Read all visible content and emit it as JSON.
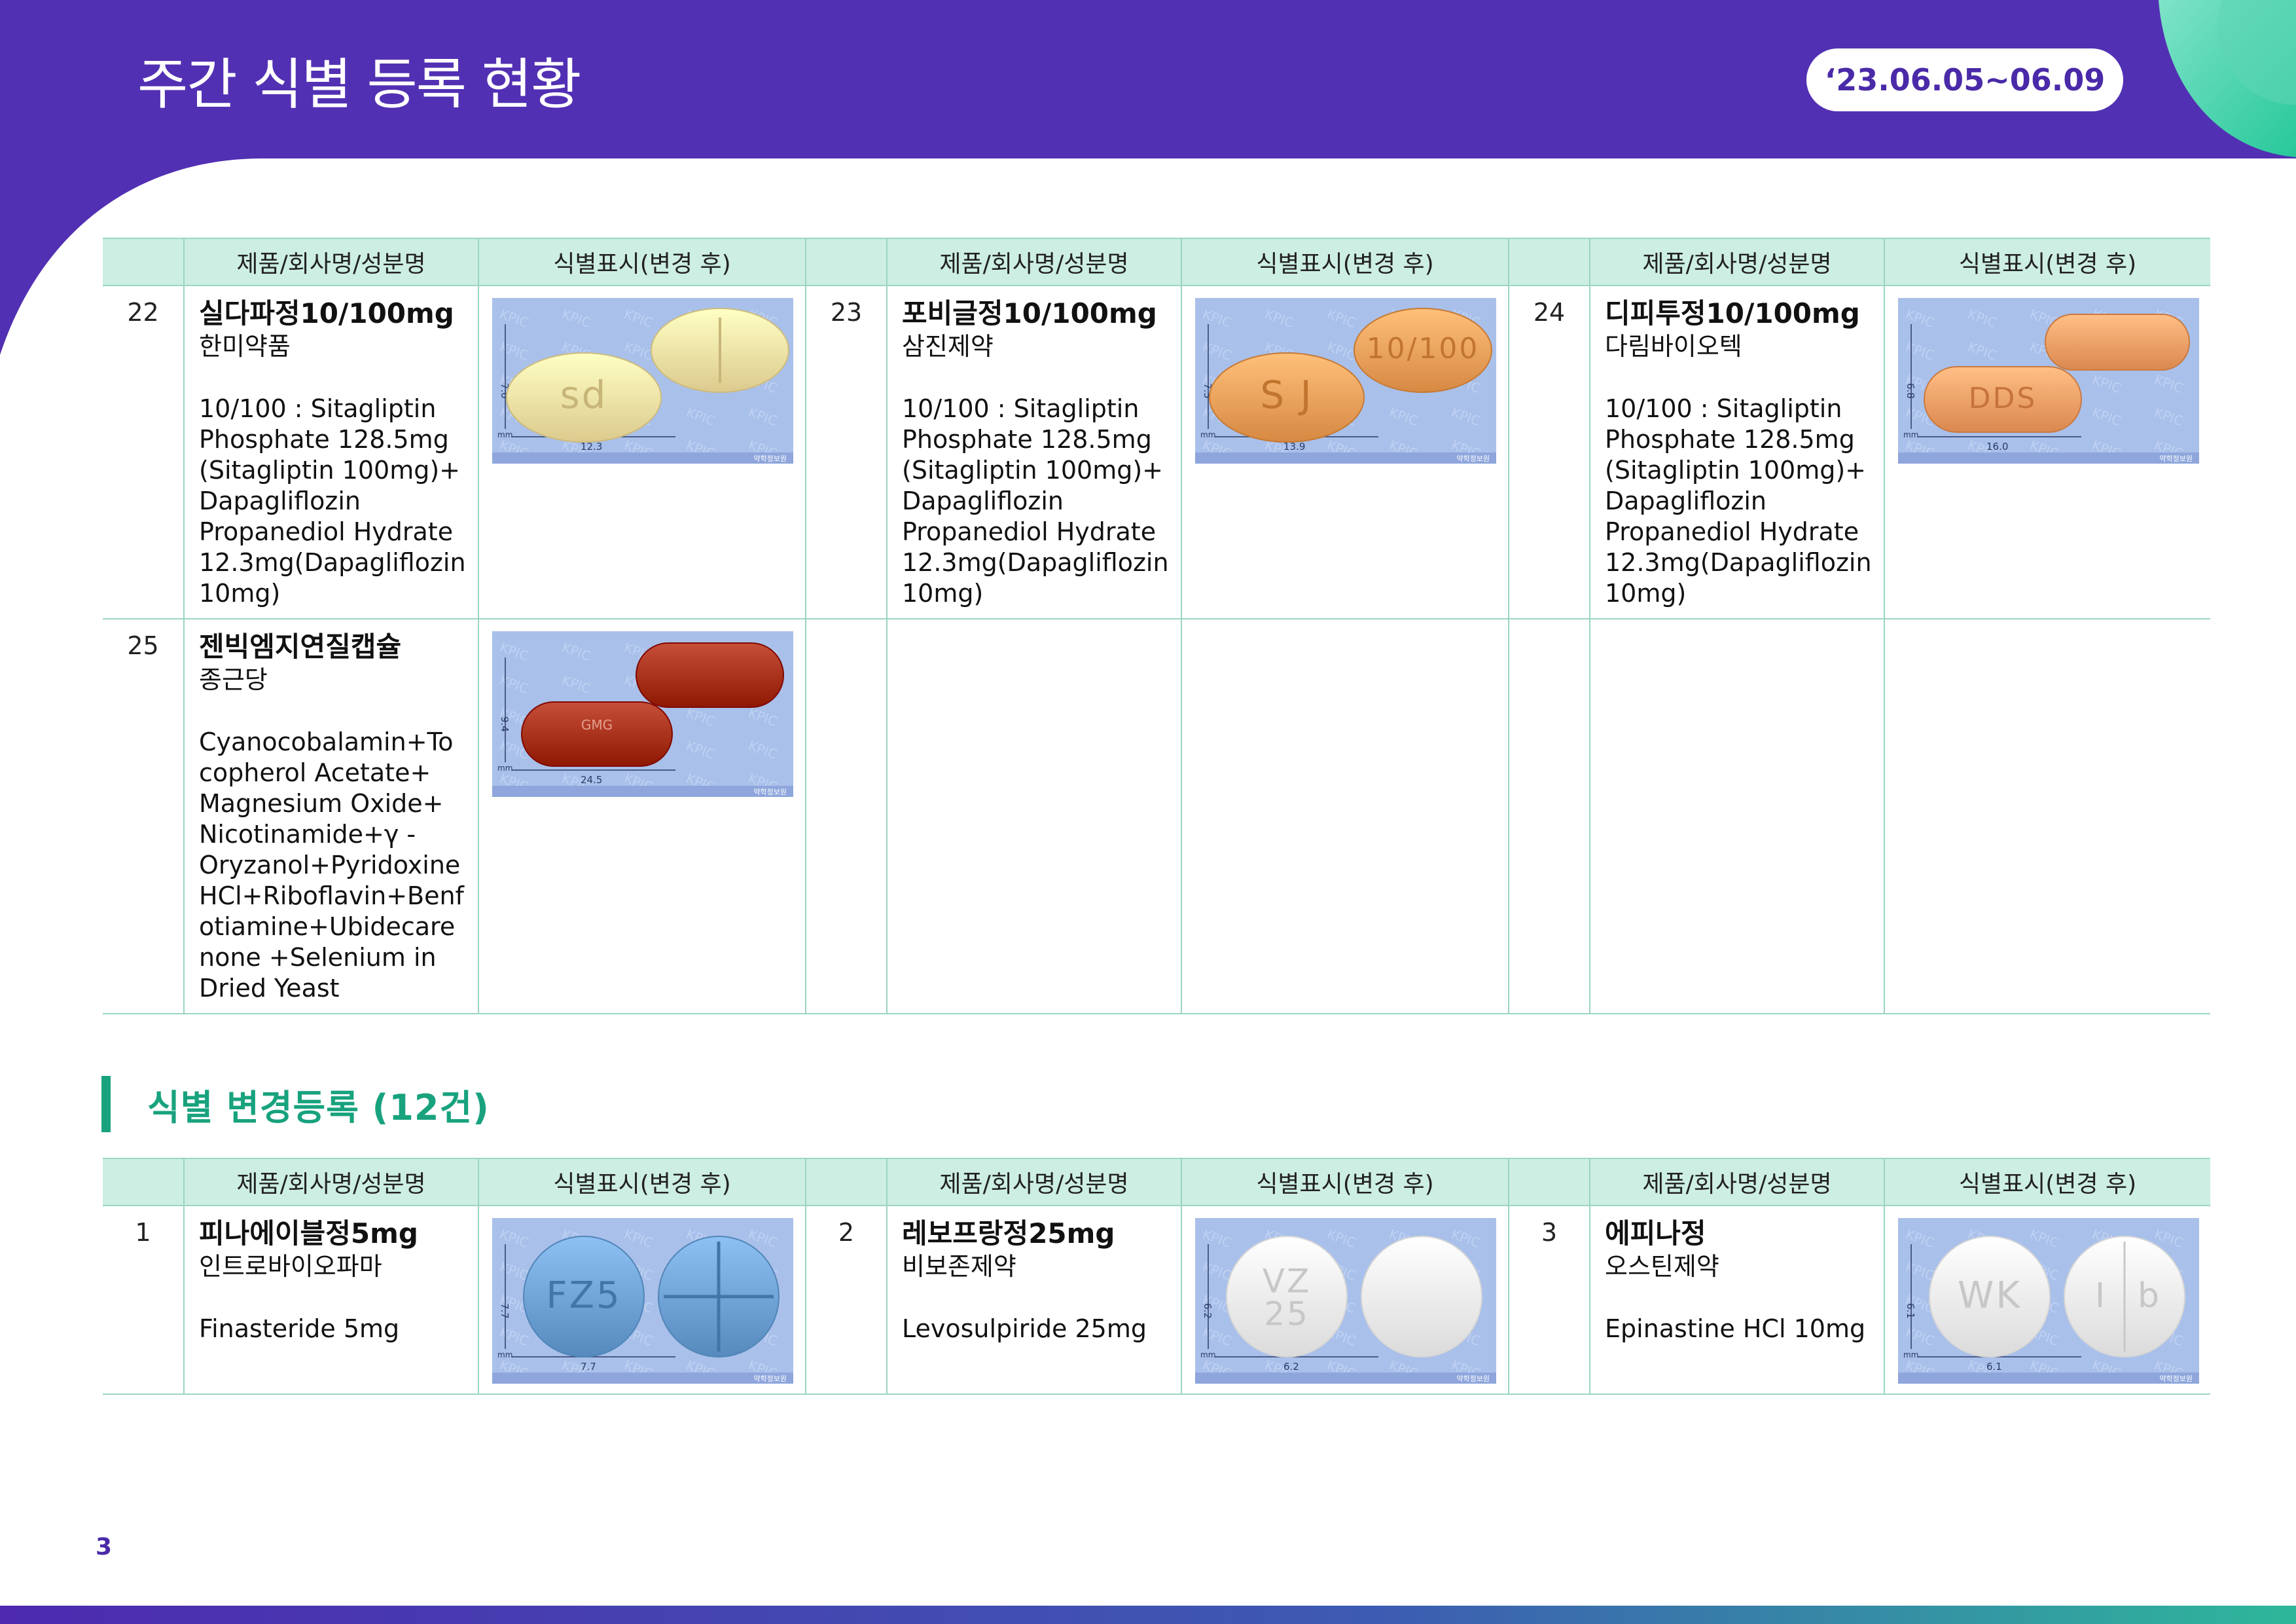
{
  "page": {
    "title": "주간 식별 등록 현황",
    "date_range": "‘23.06.05~06.09",
    "page_number": "3"
  },
  "colors": {
    "header": "#5230b3",
    "accent_green": "#18a27e",
    "table_header": "#cdeee3"
  },
  "table_headers": {
    "product": "제품/회사명/성분명",
    "marking": "식별표시(변경 후)"
  },
  "new_registrations": [
    {
      "no": "22",
      "name": "실다파정10/100mg",
      "company": "한미약품",
      "ingredients": "10/100 : Sitagliptin Phosphate 128.5mg (Sitagliptin 100mg)+ Dapagliflozin Propanediol Hydrate 12.3mg(Dapagliflozin 10mg)",
      "image": {
        "shape": "oval",
        "color": "#f5e3a6",
        "front_mark": "sd",
        "back_mark": "",
        "height_label": "7.0",
        "width_label": "12.3",
        "unit": "mm",
        "watermark": "KPIC",
        "credit": "약학정보원"
      }
    },
    {
      "no": "23",
      "name": "포비글정10/100mg",
      "company": "삼진제약",
      "ingredients": "10/100 : Sitagliptin Phosphate 128.5mg (Sitagliptin 100mg)+ Dapagliflozin Propanediol Hydrate 12.3mg(Dapagliflozin 10mg)",
      "image": {
        "shape": "oval",
        "color": "#efa25c",
        "front_mark": "S J",
        "back_mark": "10/100",
        "height_label": "7.5",
        "width_label": "13.9",
        "unit": "mm",
        "watermark": "KPIC",
        "credit": "약학정보원"
      }
    },
    {
      "no": "24",
      "name": "디피투정10/100mg",
      "company": "다림바이오텍",
      "ingredients": "10/100 : Sitagliptin Phosphate 128.5mg (Sitagliptin 100mg)+ Dapagliflozin Propanediol Hydrate 12.3mg(Dapagliflozin 10mg)",
      "image": {
        "shape": "capsule",
        "color": "#f3a168",
        "front_mark": "DDS",
        "back_mark": "",
        "height_label": "6.8",
        "width_label": "16.0",
        "unit": "mm",
        "watermark": "KPIC",
        "credit": "약학정보원"
      }
    },
    {
      "no": "25",
      "name": "젠빅엠지연질캡슐",
      "company": "종근당",
      "ingredients": "Cyanocobalamin+Tocopherol Acetate+ Magnesium Oxide+ Nicotinamide+γ -Oryzanol+Pyridoxine HCl+Riboflavin+Benfotiamine+Ubidecarenone +Selenium in Dried Yeast",
      "image": {
        "shape": "softgel",
        "color": "#a8311b",
        "front_mark": "GMG",
        "back_mark": "",
        "height_label": "9.4",
        "width_label": "24.5",
        "unit": "mm",
        "watermark": "KPIC",
        "credit": "약학정보원"
      }
    }
  ],
  "change_section": {
    "title": "식별 변경등록 (12건)",
    "items": [
      {
        "no": "1",
        "name": "피나에이블정5mg",
        "company": "인트로바이오파마",
        "ingredients": "Finasteride 5mg",
        "image": {
          "shape": "round",
          "color": "#6fa3d6",
          "front_mark": "FZ5",
          "back_mark": "+",
          "height_label": "7.7",
          "width_label": "7.7",
          "unit": "mm",
          "watermark": "KPIC",
          "credit": "약학정보원"
        }
      },
      {
        "no": "2",
        "name": "레보프랑정25mg",
        "company": "비보존제약",
        "ingredients": "Levosulpiride 25mg",
        "image": {
          "shape": "round",
          "color": "#f4f4f4",
          "front_mark": "VZ 25",
          "back_mark": "",
          "height_label": "6.2",
          "width_label": "6.2",
          "unit": "mm",
          "watermark": "KPIC",
          "credit": "약학정보원"
        }
      },
      {
        "no": "3",
        "name": "에피나정",
        "company": "오스틴제약",
        "ingredients": "Epinastine HCl 10mg",
        "image": {
          "shape": "round",
          "color": "#f4f4f4",
          "front_mark": "WK",
          "back_mark": "I b",
          "height_label": "6.1",
          "width_label": "6.1",
          "unit": "mm",
          "watermark": "KPIC",
          "credit": "약학정보원"
        }
      }
    ]
  }
}
